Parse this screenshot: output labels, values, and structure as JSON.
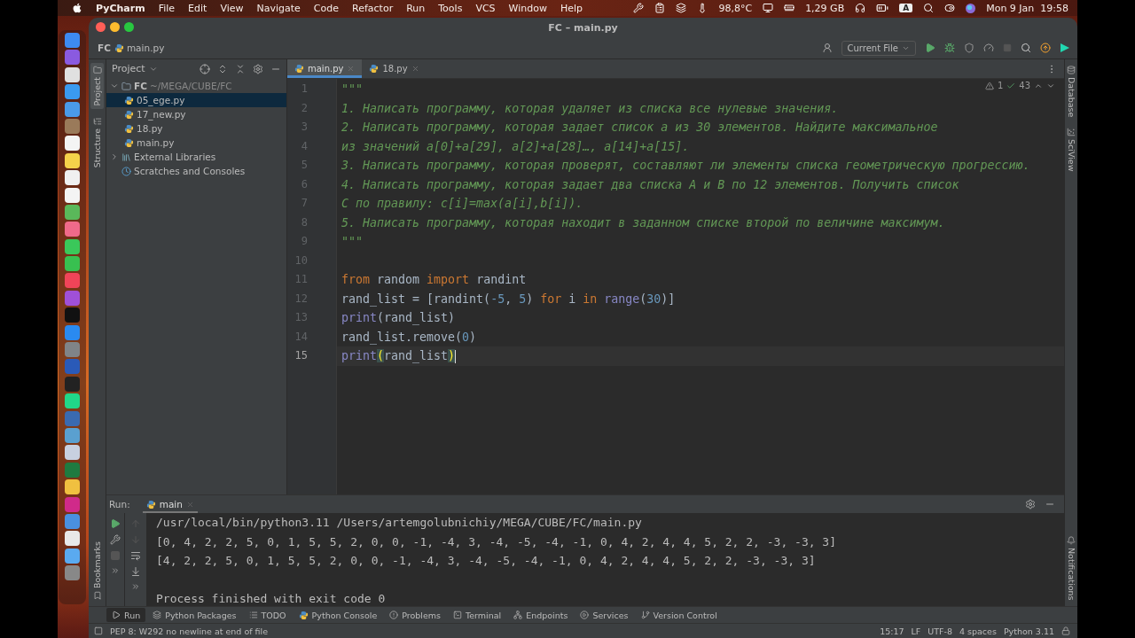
{
  "menu_bar": {
    "app": "PyCharm",
    "menus": [
      "File",
      "Edit",
      "View",
      "Navigate",
      "Code",
      "Refactor",
      "Run",
      "Tools",
      "VCS",
      "Window",
      "Help"
    ],
    "temperature": "98,8°C",
    "memory": "1,29 GB",
    "input_source": "A",
    "clock": "Mon 9 Jan  19:58"
  },
  "window": {
    "title": "FC – main.py"
  },
  "breadcrumbs": [
    "FC",
    "main.py"
  ],
  "toolbar": {
    "run_config": "Current File"
  },
  "side_tabs_left": [
    {
      "label": "Project",
      "selected": true,
      "kind": "project"
    },
    {
      "label": "Structure",
      "selected": false,
      "kind": "structure"
    }
  ],
  "side_tabs_left_bottom": [
    {
      "label": "Bookmarks",
      "kind": "bookmarks"
    }
  ],
  "side_tabs_right": [
    {
      "label": "Database",
      "kind": "database"
    },
    {
      "label": "SciView",
      "kind": "sciview"
    }
  ],
  "side_tabs_right_bottom": [
    {
      "label": "Notifications",
      "kind": "notifications"
    }
  ],
  "project_panel": {
    "title": "Project",
    "tree": [
      {
        "label": "FC",
        "path": "~/MEGA/CUBE/FC",
        "kind": "folder",
        "expanded": true,
        "selected": false,
        "children": [
          {
            "label": "05_ege.py",
            "kind": "file",
            "selected": true
          },
          {
            "label": "17_new.py",
            "kind": "file",
            "selected": false
          },
          {
            "label": "18.py",
            "kind": "file",
            "selected": false
          },
          {
            "label": "main.py",
            "kind": "file",
            "selected": false
          }
        ]
      },
      {
        "label": "External Libraries",
        "kind": "libraries",
        "expanded": false,
        "selected": false
      },
      {
        "label": "Scratches and Consoles",
        "kind": "scratches",
        "selected": false
      }
    ]
  },
  "editor_tabs": [
    {
      "label": "main.py",
      "selected": true
    },
    {
      "label": "18.py",
      "selected": false
    }
  ],
  "inspections": {
    "warnings": "1",
    "ok": "43"
  },
  "code_lines": [
    {
      "number": "1",
      "current": false,
      "tokens": [
        {
          "kind": "string",
          "text": "\"\"\""
        }
      ]
    },
    {
      "number": "2",
      "current": false,
      "tokens": [
        {
          "kind": "doc",
          "text": "1. Написать программу, которая удаляет из списка все нулевые значения."
        }
      ]
    },
    {
      "number": "3",
      "current": false,
      "tokens": [
        {
          "kind": "doc",
          "text": "2. Написать программу, которая задает список a из 30 элементов. Найдите максимальное"
        }
      ]
    },
    {
      "number": "4",
      "current": false,
      "tokens": [
        {
          "kind": "doc",
          "text": "из значений a[0]+a[29], a[2]+a[28]…, a[14]+a[15]."
        }
      ]
    },
    {
      "number": "5",
      "current": false,
      "tokens": [
        {
          "kind": "doc",
          "text": "3. Написать программу, которая проверят, составляют ли элементы списка геометрическую прогрессию."
        }
      ]
    },
    {
      "number": "6",
      "current": false,
      "tokens": [
        {
          "kind": "doc",
          "text": "4. Написать программу, которая задает два списка A и B по 12 элементов. Получить список"
        }
      ]
    },
    {
      "number": "7",
      "current": false,
      "tokens": [
        {
          "kind": "doc",
          "text": "C по правилу: c[i]=max(a[i],b[i])."
        }
      ]
    },
    {
      "number": "8",
      "current": false,
      "tokens": [
        {
          "kind": "doc",
          "text": "5. Написать программу, которая находит в заданном списке второй по величине максимум."
        }
      ]
    },
    {
      "number": "9",
      "current": false,
      "tokens": [
        {
          "kind": "string",
          "text": "\"\"\""
        }
      ]
    },
    {
      "number": "10",
      "current": false
    },
    {
      "number": "11",
      "current": false,
      "tokens": [
        {
          "kind": "keyword",
          "text": "from"
        },
        {
          "kind": "plain",
          "text": " random "
        },
        {
          "kind": "keyword",
          "text": "import"
        },
        {
          "kind": "plain",
          "text": " randint"
        }
      ]
    },
    {
      "number": "12",
      "current": false,
      "tokens": [
        {
          "kind": "plain",
          "text": "rand_list = [randint("
        },
        {
          "kind": "number",
          "text": "-5"
        },
        {
          "kind": "plain",
          "text": ", "
        },
        {
          "kind": "number",
          "text": "5"
        },
        {
          "kind": "plain",
          "text": ") "
        },
        {
          "kind": "keyword",
          "text": "for"
        },
        {
          "kind": "plain",
          "text": " i "
        },
        {
          "kind": "keyword",
          "text": "in"
        },
        {
          "kind": "builtin",
          "text": "range",
          "space_before": true
        },
        {
          "kind": "plain",
          "text": "("
        },
        {
          "kind": "number",
          "text": "30"
        },
        {
          "kind": "plain",
          "text": ")]"
        }
      ]
    },
    {
      "number": "13",
      "current": false,
      "tokens": [
        {
          "kind": "builtin",
          "text": "print"
        },
        {
          "kind": "plain",
          "text": "(rand_list)"
        }
      ]
    },
    {
      "number": "14",
      "current": false,
      "tokens": [
        {
          "kind": "plain",
          "text": "rand_list.remove("
        },
        {
          "kind": "number",
          "text": "0"
        },
        {
          "kind": "plain",
          "text": ")"
        }
      ]
    },
    {
      "number": "15",
      "current": true,
      "tokens": [
        {
          "kind": "builtin",
          "text": "print"
        },
        {
          "kind": "bracket",
          "text": "("
        },
        {
          "kind": "plain",
          "text": "rand_list"
        },
        {
          "kind": "bracket",
          "text": ")"
        }
      ]
    }
  ],
  "run_panel": {
    "label": "Run:",
    "tab": "main",
    "output": [
      {
        "kind": "command",
        "text": "/usr/local/bin/python3.11 /Users/artemgolubnichiy/MEGA/CUBE/FC/main.py"
      },
      {
        "kind": "output",
        "text": "[0, 4, 2, 2, 5, 0, 1, 5, 5, 2, 0, 0, -1, -4, 3, -4, -5, -4, -1, 0, 4, 2, 4, 4, 5, 2, 2, -3, -3, 3]"
      },
      {
        "kind": "output",
        "text": "[4, 2, 2, 5, 0, 1, 5, 5, 2, 0, 0, -1, -4, 3, -4, -5, -4, -1, 0, 4, 2, 4, 4, 5, 2, 2, -3, -3, 3]"
      },
      {
        "kind": "exit",
        "text": "Process finished with exit code 0"
      }
    ]
  },
  "tool_windows": [
    {
      "label": "Run",
      "kind": "run",
      "selected": true
    },
    {
      "label": "Python Packages",
      "kind": "packages",
      "selected": false
    },
    {
      "label": "TODO",
      "kind": "todo",
      "selected": false
    },
    {
      "label": "Python Console",
      "kind": "console",
      "selected": false
    },
    {
      "label": "Problems",
      "kind": "problems",
      "selected": false
    },
    {
      "label": "Terminal",
      "kind": "terminal",
      "selected": false
    },
    {
      "label": "Endpoints",
      "kind": "endpoints",
      "selected": false
    },
    {
      "label": "Services",
      "kind": "services",
      "selected": false
    },
    {
      "label": "Version Control",
      "kind": "vcs",
      "selected": false
    }
  ],
  "status_bar": {
    "message": "PEP 8: W292 no newline at end of file",
    "items": [
      "15:17",
      "LF",
      "UTF-8",
      "4 spaces",
      "Python 3.11"
    ]
  }
}
